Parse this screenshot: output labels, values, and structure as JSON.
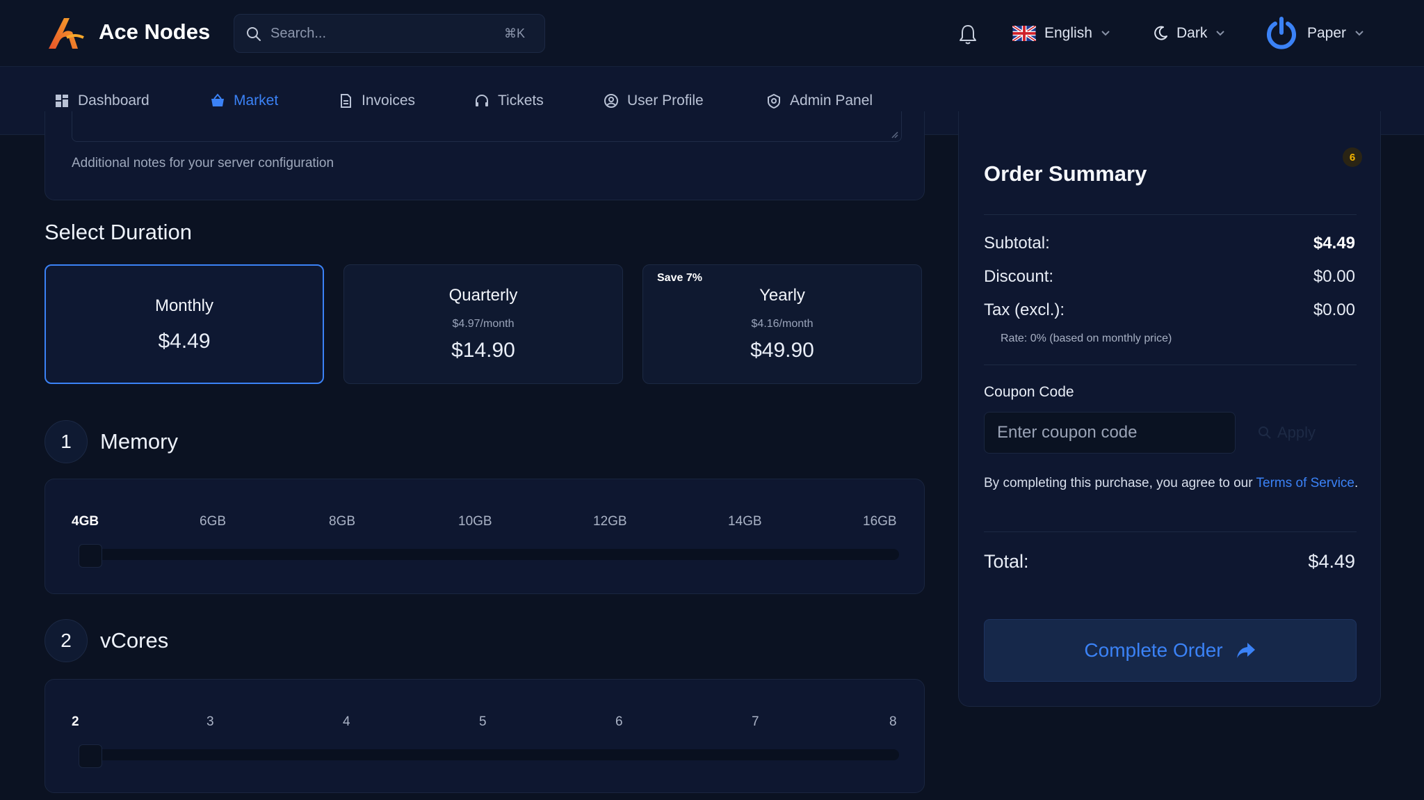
{
  "app": {
    "brand": "Ace Nodes",
    "search_placeholder": "Search...",
    "search_shortcut": "⌘K",
    "language": "English",
    "theme": "Dark",
    "user_name": "Paper",
    "accent_color": "#3b82f6"
  },
  "nav": {
    "items": [
      {
        "label": "Dashboard",
        "icon": "grid-icon",
        "active": false
      },
      {
        "label": "Market",
        "icon": "basket-icon",
        "active": true
      },
      {
        "label": "Invoices",
        "icon": "document-icon",
        "active": false
      },
      {
        "label": "Tickets",
        "icon": "headset-icon",
        "active": false
      },
      {
        "label": "User Profile",
        "icon": "user-circle-icon",
        "active": false
      },
      {
        "label": "Admin Panel",
        "icon": "shield-icon",
        "active": false
      }
    ]
  },
  "notes": {
    "helper": "Additional notes for your server configuration"
  },
  "duration": {
    "title": "Select Duration",
    "options": [
      {
        "name": "Monthly",
        "per_month": "",
        "price": "$4.49",
        "badge": "",
        "selected": true
      },
      {
        "name": "Quarterly",
        "per_month": "$4.97/month",
        "price": "$14.90",
        "badge": "",
        "selected": false
      },
      {
        "name": "Yearly",
        "per_month": "$4.16/month",
        "price": "$49.90",
        "badge": "Save 7%",
        "selected": false
      }
    ]
  },
  "memory": {
    "step": "1",
    "title": "Memory",
    "ticks": [
      "4GB",
      "6GB",
      "8GB",
      "10GB",
      "12GB",
      "14GB",
      "16GB"
    ],
    "selected_index": 0
  },
  "vcores": {
    "step": "2",
    "title": "vCores",
    "ticks": [
      "2",
      "3",
      "4",
      "5",
      "6",
      "7",
      "8"
    ],
    "selected_index": 0
  },
  "summary": {
    "title": "Order Summary",
    "badge_count": "6",
    "subtotal_label": "Subtotal:",
    "subtotal_value": "$4.49",
    "discount_label": "Discount:",
    "discount_value": "$0.00",
    "tax_label": "Tax (excl.):",
    "tax_value": "$0.00",
    "rate_note": "Rate: 0% (based on monthly price)",
    "coupon_label": "Coupon Code",
    "coupon_placeholder": "Enter coupon code",
    "apply_label": "Apply",
    "agree_text": "By completing this purchase, you agree to our",
    "terms_link": "Terms of Service",
    "total_label": "Total:",
    "total_value": "$4.49",
    "complete_label": "Complete Order"
  }
}
